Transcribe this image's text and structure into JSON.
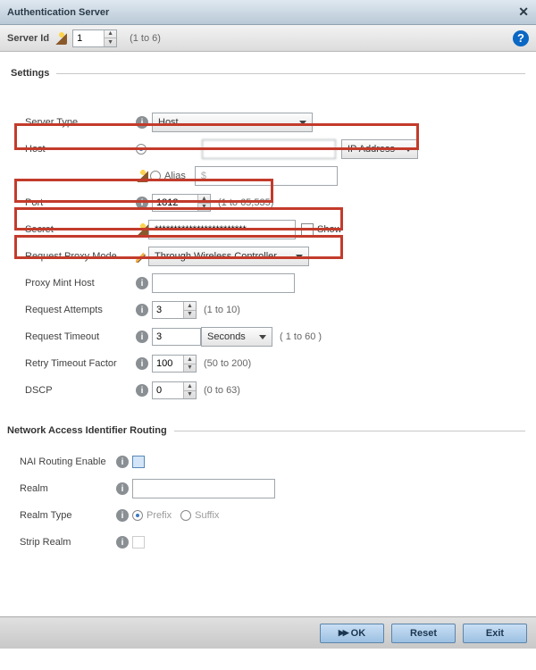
{
  "window": {
    "title": "Authentication Server",
    "close_glyph": "✕"
  },
  "toolbar": {
    "label": "Server Id",
    "value": "1",
    "range": "(1 to 6)",
    "help_glyph": "?"
  },
  "sections": {
    "settings_title": "Settings",
    "nai_title": "Network Access Identifier Routing"
  },
  "fields": {
    "server_type": {
      "label": "Server Type",
      "value": "Host"
    },
    "host": {
      "label": "Host",
      "ip_radio": "",
      "alias_radio": "Alias",
      "ip_value": "",
      "ip_button": "IP Address",
      "alias_value": "$"
    },
    "port": {
      "label": "Port",
      "value": "1812",
      "range": "(1 to 65,535)"
    },
    "secret": {
      "label": "Secret",
      "value": "************************",
      "show": "Show"
    },
    "proxy": {
      "label": "Request Proxy Mode",
      "value": "Through Wireless Controller"
    },
    "mint": {
      "label": "Proxy Mint Host",
      "value": ""
    },
    "attempts": {
      "label": "Request Attempts",
      "value": "3",
      "range": "(1 to 10)"
    },
    "timeout": {
      "label": "Request Timeout",
      "value": "3",
      "unit": "Seconds",
      "range": "( 1 to 60 )"
    },
    "retry": {
      "label": "Retry Timeout Factor",
      "value": "100",
      "range": "(50 to 200)"
    },
    "dscp": {
      "label": "DSCP",
      "value": "0",
      "range": "(0 to 63)"
    },
    "nai_enable": {
      "label": "NAI Routing Enable"
    },
    "realm": {
      "label": "Realm",
      "value": ""
    },
    "realm_type": {
      "label": "Realm Type",
      "opt_prefix": "Prefix",
      "opt_suffix": "Suffix"
    },
    "strip": {
      "label": "Strip Realm"
    }
  },
  "footer": {
    "ok": "OK",
    "reset": "Reset",
    "exit": "Exit"
  },
  "icons": {
    "info": "i",
    "up": "▲",
    "down": "▼"
  }
}
